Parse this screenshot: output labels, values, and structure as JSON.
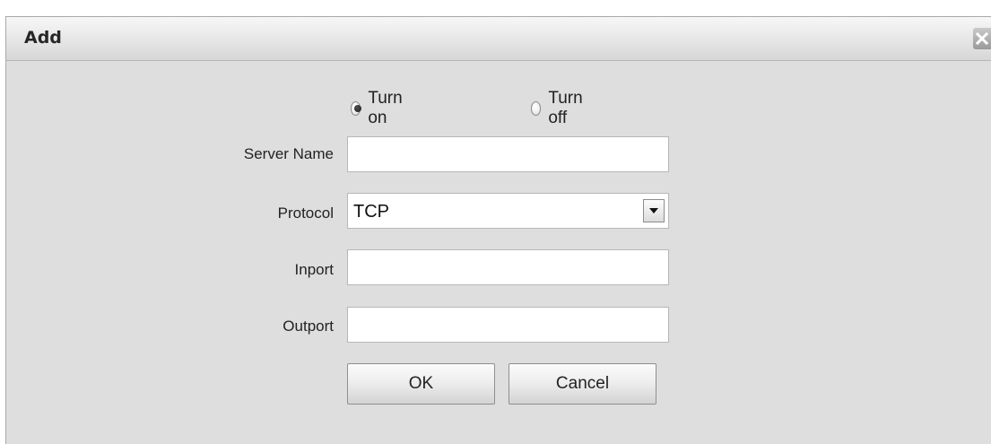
{
  "dialog": {
    "title": "Add",
    "close_icon": "close-icon"
  },
  "status": {
    "options": [
      {
        "label": "Turn on",
        "checked": true
      },
      {
        "label": "Turn off",
        "checked": false
      }
    ]
  },
  "form": {
    "server_name": {
      "label": "Server Name",
      "value": ""
    },
    "protocol": {
      "label": "Protocol",
      "value": "TCP",
      "arrow_icon": "chevron-down-icon"
    },
    "inport": {
      "label": "Inport",
      "value": ""
    },
    "outport": {
      "label": "Outport",
      "value": ""
    }
  },
  "buttons": {
    "ok": "OK",
    "cancel": "Cancel"
  }
}
